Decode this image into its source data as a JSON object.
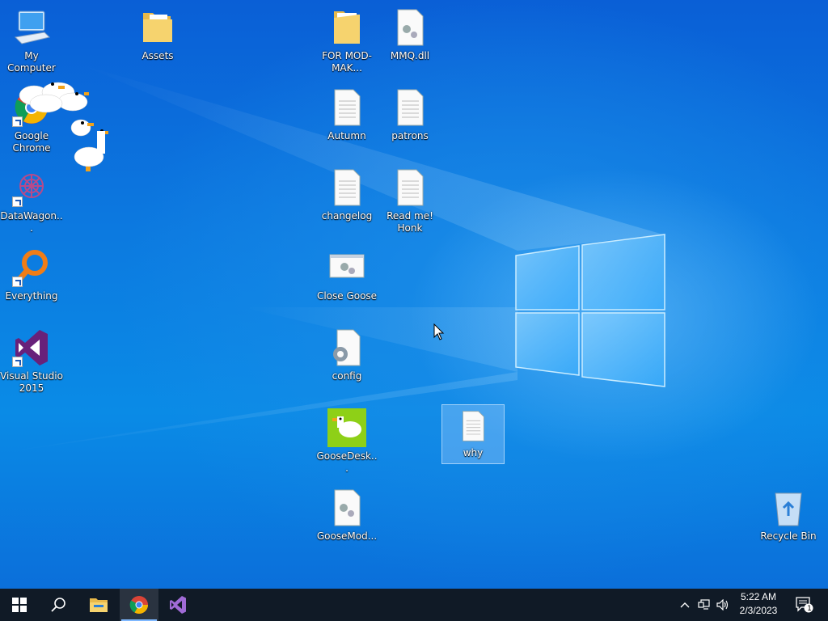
{
  "desktop": {
    "icons": [
      {
        "label": "My Computer"
      },
      {
        "label": "Assets"
      },
      {
        "label": "FOR MOD-MAK..."
      },
      {
        "label": "MMQ.dll"
      },
      {
        "label": "Google Chrome"
      },
      {
        "label": "Autumn"
      },
      {
        "label": "patrons"
      },
      {
        "label": "DataWagon..."
      },
      {
        "label": "changelog"
      },
      {
        "label": "Read me! Honk"
      },
      {
        "label": "Close Goose"
      },
      {
        "label": "Everything"
      },
      {
        "label": "config"
      },
      {
        "label": "Visual Studio 2015"
      },
      {
        "label": "GooseDesk..."
      },
      {
        "label": "why"
      },
      {
        "label": "GooseMod..."
      },
      {
        "label": "Recycle Bin"
      }
    ]
  },
  "taskbar": {
    "buttons": [
      {
        "icon": "windows-start-icon"
      },
      {
        "icon": "search-icon"
      },
      {
        "icon": "file-explorer-icon"
      },
      {
        "icon": "chrome-icon"
      },
      {
        "icon": "visual-studio-icon"
      }
    ],
    "tray": {
      "time": "5:22 AM",
      "date": "2/3/2023",
      "notification_count": "1"
    }
  },
  "colors": {
    "accent": "#0b78e3",
    "taskbar": "#101a26",
    "goose_bg": "#8ed017",
    "vs_purple": "#68217a"
  }
}
